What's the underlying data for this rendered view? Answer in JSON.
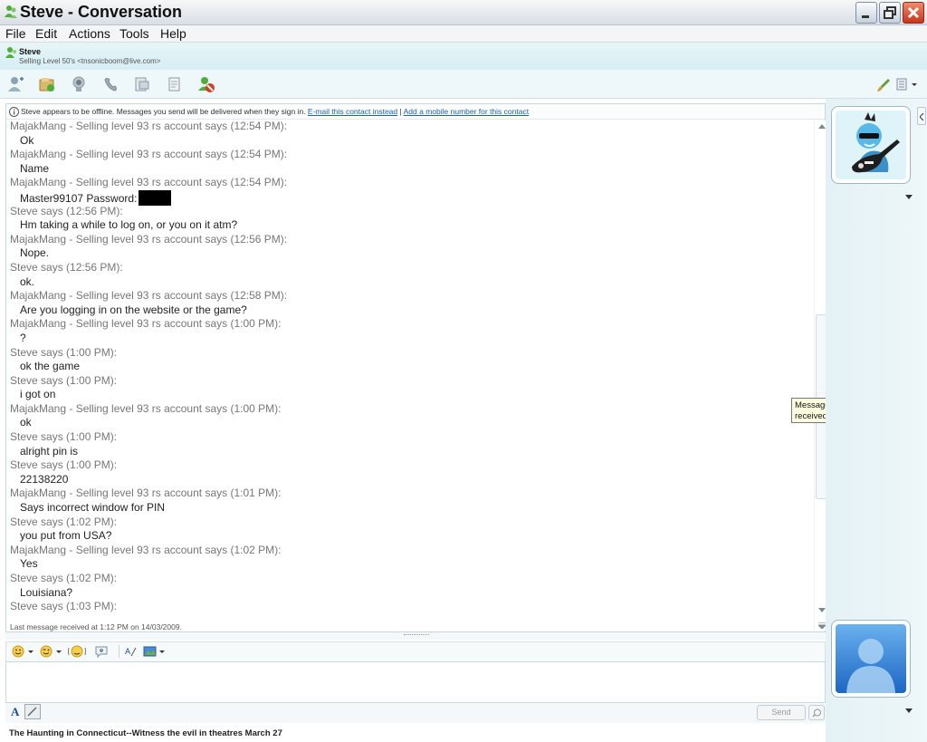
{
  "window": {
    "title": "Steve - Conversation"
  },
  "menu": {
    "items": [
      "File",
      "Edit",
      "Actions",
      "Tools",
      "Help"
    ]
  },
  "contact": {
    "name": "Steve",
    "personal_message": "Selling Level 50's <tnsonicboom@live.com>"
  },
  "infobar": {
    "text": "Steve appears to be offline. Messages you send will be delivered when they sign in.",
    "link1": "E-mail this contact instead",
    "separator": "|",
    "link2": "Add a mobile number for this contact"
  },
  "messages": [
    {
      "sender": "MajakMang - Selling level 93 rs account says (12:54 PM):",
      "body": "Ok"
    },
    {
      "sender": "MajakMang - Selling level 93 rs account says (12:54 PM):",
      "body": "Name"
    },
    {
      "sender": "MajakMang - Selling level 93 rs account says (12:54 PM):",
      "body": "Master99107 Password:",
      "redacted": true
    },
    {
      "sender": "Steve says (12:56 PM):",
      "body": "Hm taking a while to log on, or you on it atm?"
    },
    {
      "sender": "MajakMang - Selling level 93 rs account says (12:56 PM):",
      "body": "Nope."
    },
    {
      "sender": "Steve says (12:56 PM):",
      "body": "ok."
    },
    {
      "sender": "MajakMang - Selling level 93 rs account says (12:58 PM):",
      "body": "Are you logging in on the website or the game?"
    },
    {
      "sender": "MajakMang - Selling level 93 rs account says (1:00 PM):",
      "body": "?"
    },
    {
      "sender": "Steve says (1:00 PM):",
      "body": "ok the game"
    },
    {
      "sender": "Steve says (1:00 PM):",
      "body": "i got on"
    },
    {
      "sender": "MajakMang - Selling level 93 rs account says (1:00 PM):",
      "body": "ok"
    },
    {
      "sender": "Steve says (1:00 PM):",
      "body": "alright pin is"
    },
    {
      "sender": "Steve says (1:00 PM):",
      "body": "22138220"
    },
    {
      "sender": "MajakMang - Selling level 93 rs account says (1:01 PM):",
      "body": "Says incorrect window for PIN"
    },
    {
      "sender": "Steve says (1:02 PM):",
      "body": "you put from USA?"
    },
    {
      "sender": "MajakMang - Selling level 93 rs account says (1:02 PM):",
      "body": "Yes"
    },
    {
      "sender": "Steve says (1:02 PM):",
      "body": "Louisiana?"
    },
    {
      "sender": "Steve says (1:03 PM):",
      "body": ""
    }
  ],
  "last_message": "Last message received at 1:12 PM on 14/03/2009.",
  "tooltip": "Messages that you've sent and received",
  "compose": {
    "send_label": "Send",
    "font_button": "A"
  },
  "ad_text": "The Haunting in Connecticut--Witness the evil in theatres March 27",
  "colors": {
    "link": "#1a62b4",
    "sender": "#777777",
    "body": "#222222",
    "tooltip_bg": "#ffffe1",
    "close_button": "#c8351b"
  }
}
